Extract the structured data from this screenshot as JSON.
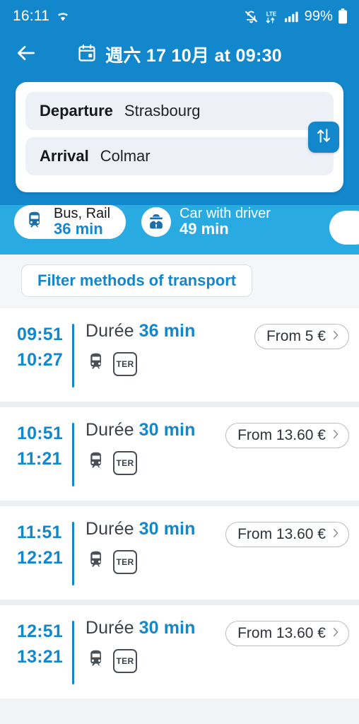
{
  "status_bar": {
    "time": "16:11",
    "wifi_icon": "wifi-icon",
    "mute_icon": "mute-bell-icon",
    "network_type": "LTE",
    "signal_icon": "signal-bars-icon",
    "battery_percent": "99%",
    "battery_icon": "battery-full-icon"
  },
  "header": {
    "back_icon": "back-arrow-icon",
    "calendar_icon": "calendar-icon",
    "title": "週六 17 10月 at 09:30"
  },
  "search_card": {
    "departure_label": "Departure",
    "departure_value": "Strasbourg",
    "arrival_label": "Arrival",
    "arrival_value": "Colmar",
    "swap_icon": "swap-vertical-icon"
  },
  "transport_modes": [
    {
      "icon": "train-icon",
      "label": "Bus, Rail",
      "duration": "36 min",
      "selected": true
    },
    {
      "icon": "chauffeur-icon",
      "label": "Car with driver",
      "duration": "49 min",
      "selected": false
    }
  ],
  "filter": {
    "label": "Filter methods of transport"
  },
  "results": [
    {
      "departure_time": "09:51",
      "arrival_time": "10:27",
      "duration_label": "Durée",
      "duration_value": "36 min",
      "transport_icon": "train-icon",
      "operator_badge": "TER",
      "price": "From 5 €",
      "chevron_icon": "chevron-right-icon"
    },
    {
      "departure_time": "10:51",
      "arrival_time": "11:21",
      "duration_label": "Durée",
      "duration_value": "30 min",
      "transport_icon": "train-icon",
      "operator_badge": "TER",
      "price": "From 13.60 €",
      "chevron_icon": "chevron-right-icon"
    },
    {
      "departure_time": "11:51",
      "arrival_time": "12:21",
      "duration_label": "Durée",
      "duration_value": "30 min",
      "transport_icon": "train-icon",
      "operator_badge": "TER",
      "price": "From 13.60 €",
      "chevron_icon": "chevron-right-icon"
    },
    {
      "departure_time": "12:51",
      "arrival_time": "13:21",
      "duration_label": "Durée",
      "duration_value": "30 min",
      "transport_icon": "train-icon",
      "operator_badge": "TER",
      "price": "From 13.60 €",
      "chevron_icon": "chevron-right-icon"
    }
  ],
  "colors": {
    "header_blue": "#1387CB",
    "accent_blue": "#29ABE2",
    "page_bg": "#eceef0"
  }
}
